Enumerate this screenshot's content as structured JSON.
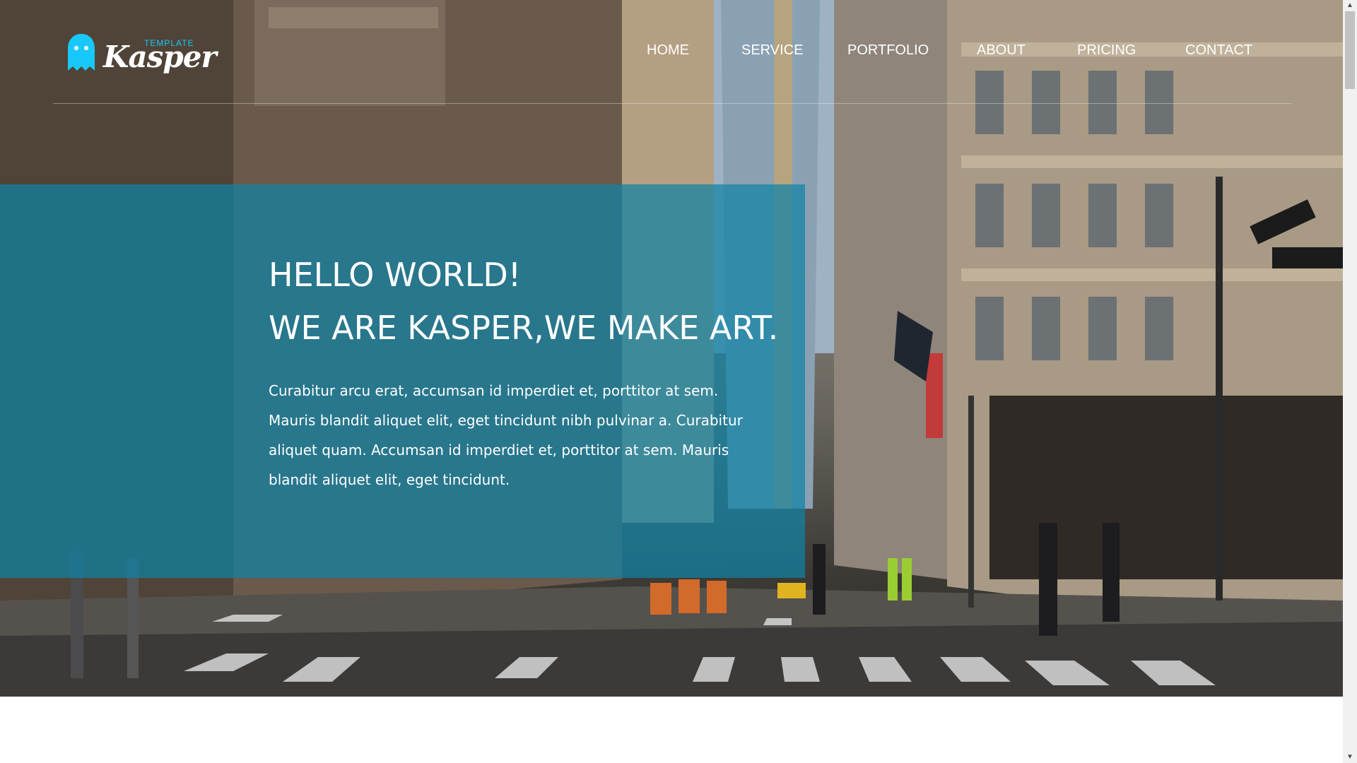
{
  "logo": {
    "tag": "TEMPLATE",
    "name": "Kasper",
    "accent_color": "#19c8fa"
  },
  "nav": {
    "items": [
      "HOME",
      "SERVICE",
      "PORTFOLIO",
      "ABOUT",
      "PRICING",
      "CONTACT"
    ]
  },
  "hero": {
    "title_line1": "HELLO WORLD!",
    "title_line2": "WE ARE KASPER,WE MAKE ART.",
    "paragraph": "Curabitur arcu erat, accumsan id imperdiet et, porttitor at sem. Mauris blandit aliquet elit, eget tincidunt nibh pulvinar a. Curabitur aliquet quam. Accumsan id imperdiet et, porttitor at sem. Mauris blandit aliquet elit, eget tincidunt.",
    "overlay_color": "#0f82a5"
  }
}
